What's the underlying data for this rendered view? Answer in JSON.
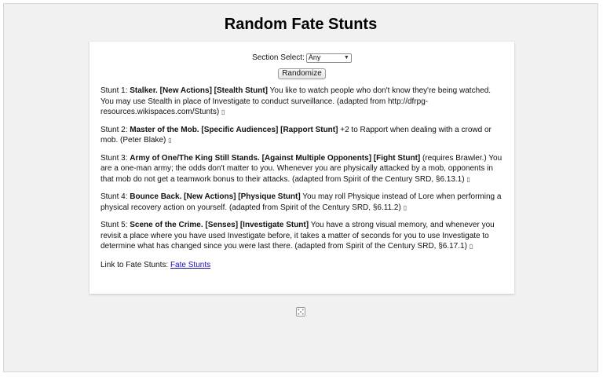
{
  "page": {
    "title": "Random Fate Stunts"
  },
  "controls": {
    "section_label": "Section Select:",
    "section_value": "Any",
    "randomize_label": "Randomize"
  },
  "stunts": [
    {
      "prefix": "Stunt 1:",
      "name": "Stalker. [New Actions] [Stealth Stunt]",
      "text": "You like to watch people who don't know they're being watched. You may use Stealth in place of Investigate to conduct surveillance. (adapted from http://dfrpg-resources.wikispaces.com/Stunts)"
    },
    {
      "prefix": "Stunt 2:",
      "name": "Master of the Mob. [Specific Audiences] [Rapport Stunt]",
      "text": "+2 to Rapport when dealing with a crowd or mob. (Peter Blake)"
    },
    {
      "prefix": "Stunt 3:",
      "name": "Army of One/The King Still Stands. [Against Multiple Opponents] [Fight Stunt]",
      "text": "(requires Brawler.) You are a one-man army; the odds don't matter to you. Whenever you are physically attacked by a mob, opponents in that mob do not get a teamwork bonus to their attacks. (adapted from Spirit of the Century SRD, §6.13.1)"
    },
    {
      "prefix": "Stunt 4:",
      "name": "Bounce Back. [New Actions] [Physique Stunt]",
      "text": "You may roll Physique instead of Lore when performing a physical recovery action on yourself. (adapted from Spirit of the Century SRD, §6.11.2)"
    },
    {
      "prefix": "Stunt 5:",
      "name": "Scene of the Crime. [Senses] [Investigate Stunt]",
      "text": "You have a strong visual memory, and whenever you revisit a place where you have used Investigate before, it takes a matter of seconds for you to use Investigate to determine what has changed since you were last there. (adapted from Spirit of the Century SRD, §6.17.1)"
    }
  ],
  "link": {
    "label": "Link to Fate Stunts:",
    "text": "Fate Stunts"
  },
  "icons": {
    "stunt_marker": "unknown-glyph-icon",
    "footer": "dice-icon"
  }
}
